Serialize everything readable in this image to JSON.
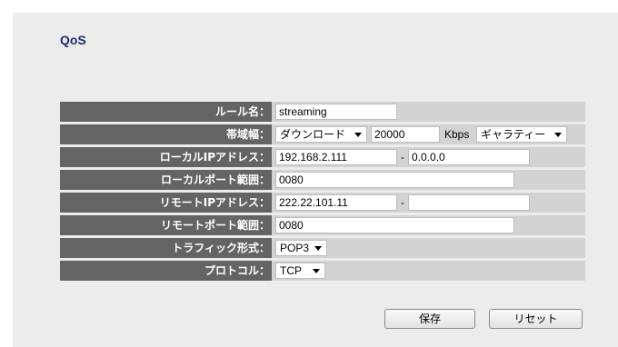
{
  "page": {
    "title": "QoS"
  },
  "form": {
    "rule_name": {
      "label": "ルール名：",
      "value": "streaming"
    },
    "bandwidth": {
      "label": "帯域幅：",
      "direction": "ダウンロード",
      "value": "20000",
      "unit": "Kbps",
      "mode": "ギャラティー"
    },
    "local_ip": {
      "label": "ローカルIPアドレス：",
      "start": "192.168.2.111",
      "separator": "-",
      "end": "0.0.0.0"
    },
    "local_port": {
      "label": "ローカルポート範囲：",
      "value": "0080"
    },
    "remote_ip": {
      "label": "リモートIPアドレス：",
      "start": "222.22.101.11",
      "separator": "-",
      "end": ""
    },
    "remote_port": {
      "label": "リモートポート範囲：",
      "value": "0080"
    },
    "traffic_type": {
      "label": "トラフィック形式：",
      "value": "POP3"
    },
    "protocol": {
      "label": "プロトコル：",
      "value": "TCP"
    }
  },
  "buttons": {
    "save": "保存",
    "reset": "リセット"
  }
}
